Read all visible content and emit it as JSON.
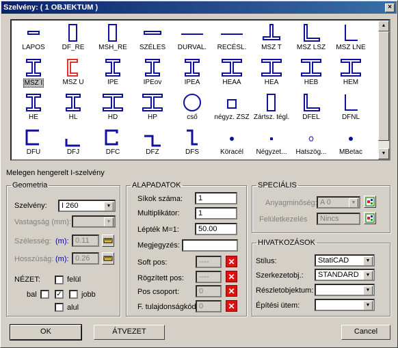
{
  "window": {
    "title": "Szelvény: ( 1 OBJEKTUM )",
    "close_glyph": "×"
  },
  "gallery": {
    "items": [
      {
        "label": "LAPOS",
        "icon": "flat-bar-icon",
        "color": "#1010a0"
      },
      {
        "label": "DF_RE",
        "icon": "rect-hollow-icon",
        "color": "#1010a0"
      },
      {
        "label": "MSH_RE",
        "icon": "rect-hollow-icon",
        "color": "#1010a0"
      },
      {
        "label": "SZÉLES",
        "icon": "wide-flat-icon",
        "color": "#1010a0"
      },
      {
        "label": "DURVAL.",
        "icon": "plate-line-icon",
        "color": "#1010a0"
      },
      {
        "label": "RECÉSL.",
        "icon": "plate-line-icon",
        "color": "#1010a0"
      },
      {
        "label": "MSZ T",
        "icon": "t-section-icon",
        "color": "#1010a0"
      },
      {
        "label": "MSZ LSZ",
        "icon": "l-angle-icon",
        "color": "#1010a0"
      },
      {
        "label": "MSZ LNE",
        "icon": "l-angle-thin-icon",
        "color": "#1010a0"
      },
      {
        "label": "MSZ I",
        "icon": "i-beam-icon",
        "color": "#1010a0",
        "selected": true
      },
      {
        "label": "MSZ U",
        "icon": "u-channel-icon",
        "color": "#e03030"
      },
      {
        "label": "IPE",
        "icon": "i-beam-icon",
        "color": "#1010a0"
      },
      {
        "label": "IPEov",
        "icon": "i-beam-icon",
        "color": "#1010a0"
      },
      {
        "label": "IPEA",
        "icon": "i-beam-icon",
        "color": "#1010a0"
      },
      {
        "label": "HEAA",
        "icon": "h-beam-icon",
        "color": "#1010a0"
      },
      {
        "label": "HEA",
        "icon": "h-beam-icon",
        "color": "#1010a0"
      },
      {
        "label": "HEB",
        "icon": "h-beam-icon",
        "color": "#1010a0"
      },
      {
        "label": "HEM",
        "icon": "h-beam-icon",
        "color": "#1010a0"
      },
      {
        "label": "HE",
        "icon": "i-beam-icon",
        "color": "#1010a0"
      },
      {
        "label": "HL",
        "icon": "i-beam-icon",
        "color": "#1010a0"
      },
      {
        "label": "HD",
        "icon": "h-beam-icon",
        "color": "#1010a0"
      },
      {
        "label": "HP",
        "icon": "h-beam-icon",
        "color": "#1010a0"
      },
      {
        "label": "cső",
        "icon": "tube-icon",
        "color": "#1010a0"
      },
      {
        "label": "négyz. ZSZ",
        "icon": "square-hollow-icon",
        "color": "#1010a0"
      },
      {
        "label": "Zártsz. tégl.",
        "icon": "rect-hollow-icon",
        "color": "#1010a0"
      },
      {
        "label": "DFEL",
        "icon": "l-angle-icon",
        "color": "#1010a0"
      },
      {
        "label": "DFNL",
        "icon": "l-angle-thin-icon",
        "color": "#1010a0"
      },
      {
        "label": "DFU",
        "icon": "c-channel-icon",
        "color": "#1010a0"
      },
      {
        "label": "DFJ",
        "icon": "j-section-icon",
        "color": "#1010a0"
      },
      {
        "label": "DFC",
        "icon": "c-lipped-icon",
        "color": "#1010a0"
      },
      {
        "label": "DFZ",
        "icon": "z-section-icon",
        "color": "#1010a0"
      },
      {
        "label": "DFS",
        "icon": "s-section-icon",
        "color": "#1010a0"
      },
      {
        "label": "Köracél",
        "icon": "round-bar-icon",
        "color": "#1010a0"
      },
      {
        "label": "Négyzet...",
        "icon": "square-bar-icon",
        "color": "#1010a0"
      },
      {
        "label": "Hatszög...",
        "icon": "hexagon-bar-icon",
        "color": "#1010a0"
      },
      {
        "label": "MBetac",
        "icon": "round-bar-icon",
        "color": "#1010a0"
      }
    ]
  },
  "description": "Melegen hengerelt I-szelvény",
  "geometria": {
    "legend": "Geometria",
    "szelveny_label": "Szelvény:",
    "szelveny_value": "I 260",
    "vastagsag_label": "Vastagság (mm):",
    "vastagsag_value": "",
    "szelesseg_label": "Szélesség:",
    "szelesseg_unit": "(m):",
    "szelesseg_value": "0.11",
    "hosszusag_label": "Hosszúság:",
    "hosszusag_unit": "(m):",
    "hosszusag_value": "0.26",
    "nezet_label": "NÉZET:",
    "felul": "felül",
    "bal": "bal",
    "jobb": "jobb",
    "alul": "alul",
    "center_checked": true
  },
  "alapadatok": {
    "legend": "ALAPADATOK",
    "sikok_label": "Síkok száma:",
    "sikok_value": "1",
    "multi_label": "Multiplikátor:",
    "multi_value": "1",
    "lepetek_label": "Lépték M=1:",
    "lepetek_value": "50.00",
    "megj_label": "Megjegyzés:",
    "megj_value": "",
    "soft_label": "Soft pos:",
    "soft_value": "----",
    "rogz_label": "Rögzített pos:",
    "rogz_value": "----",
    "pos_label": "Pos csoport:",
    "pos_value": "0",
    "ftul_label": "F. tulajdonságkód:",
    "ftul_value": "0"
  },
  "specialis": {
    "legend": "SPECIÁLIS",
    "anyag_label": "Anyagminőség:",
    "anyag_value": "A 0",
    "felulet_label": "Felületkezelés",
    "felulet_value": "Nincs"
  },
  "hivatkozasok": {
    "legend": "HIVATKOZÁSOK",
    "stilus_label": "Stílus:",
    "stilus_value": "StatiCAD",
    "szerk_label": "Szerkezetobj.:",
    "szerk_value": "STANDARD",
    "reszlet_label": "Részletobjektum:",
    "reszlet_value": "",
    "epitesi_label": "Építési ütem:",
    "epitesi_value": ""
  },
  "buttons": {
    "ok": "OK",
    "atvezet": "ÁTVEZET",
    "cancel": "Cancel"
  }
}
